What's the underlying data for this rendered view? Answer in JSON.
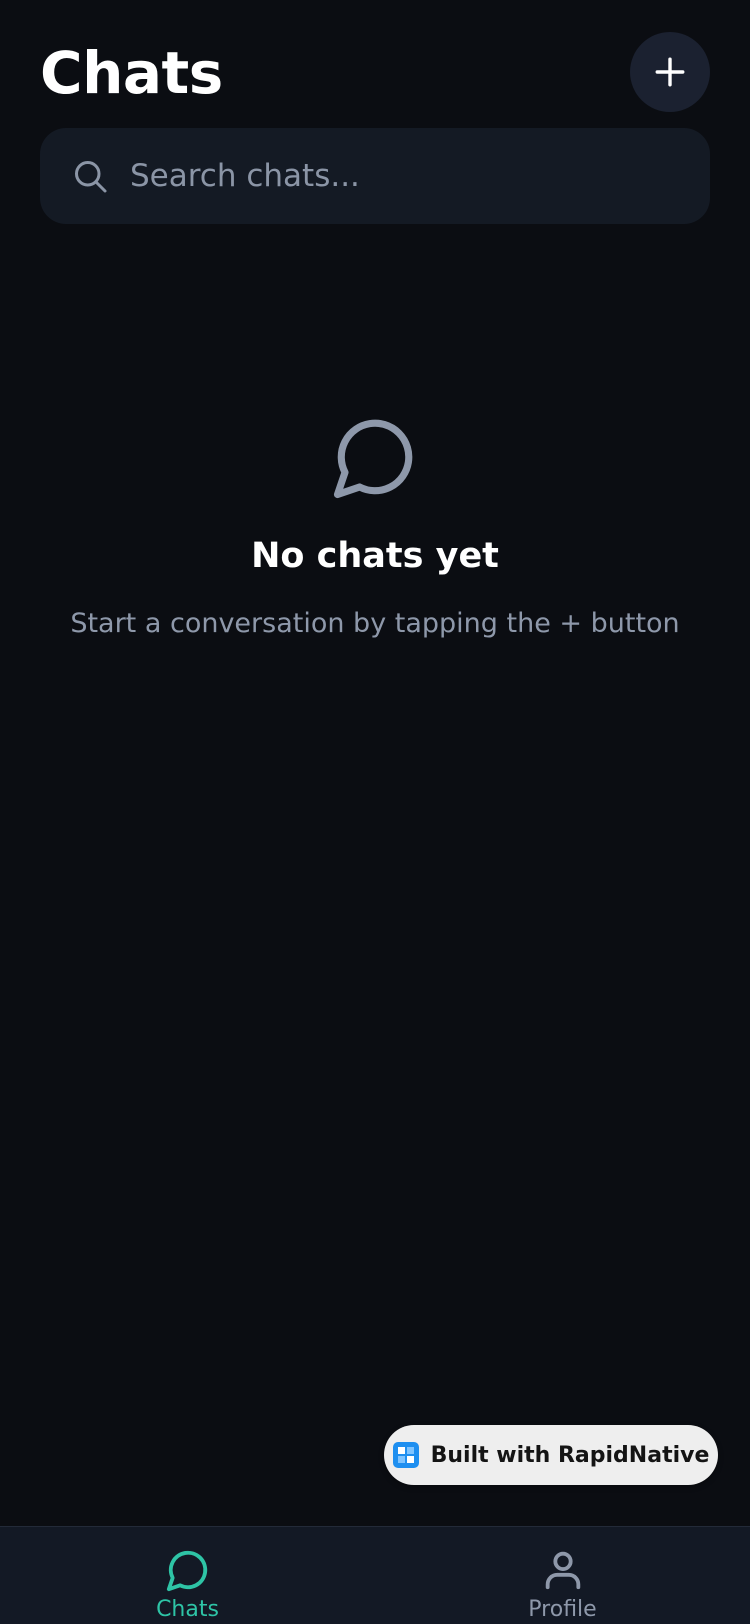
{
  "header": {
    "title": "Chats",
    "new_chat_icon": "plus-icon"
  },
  "search": {
    "placeholder": "Search chats...",
    "value": "",
    "icon": "search-icon"
  },
  "empty_state": {
    "icon": "chat-bubble-icon",
    "title": "No chats yet",
    "subtitle": "Start a conversation by tapping the + button"
  },
  "badge": {
    "label": "Built with RapidNative",
    "icon": "rapidnative-logo"
  },
  "tabs": [
    {
      "label": "Chats",
      "icon": "chat-bubble-icon",
      "active": true
    },
    {
      "label": "Profile",
      "icon": "user-icon",
      "active": false
    }
  ],
  "colors": {
    "background": "#0b0d12",
    "surface": "#141a24",
    "accent": "#2ec4a6",
    "muted": "#8e98aa"
  }
}
